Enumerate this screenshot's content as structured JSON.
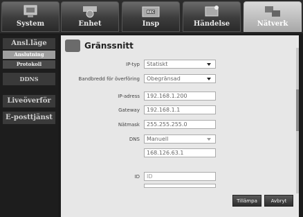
{
  "top_tabs": [
    {
      "label": "System",
      "icon": "monitor-icon"
    },
    {
      "label": "Enhet",
      "icon": "camera-icon"
    },
    {
      "label": "Insp",
      "icon": "recorder-icon"
    },
    {
      "label": "Händelse",
      "icon": "event-icon"
    },
    {
      "label": "Nätverk",
      "icon": "network-icon"
    }
  ],
  "sidebar": {
    "items": [
      {
        "label": "Ansl.läge"
      },
      {
        "label": "Anslutning"
      },
      {
        "label": "Protokoll"
      },
      {
        "label": "DDNS"
      },
      {
        "label": "Liveöverför"
      },
      {
        "label": "E-posttjänst"
      }
    ]
  },
  "page": {
    "title": "Gränssnitt",
    "fields": [
      {
        "label": "IP-typ",
        "value": "Statiskt"
      },
      {
        "label": "Bandbredd för överföring",
        "value": "Obegränsad"
      },
      {
        "label": "IP-adress",
        "value": "192.168.1.200"
      },
      {
        "label": "Gateway",
        "value": "192.168.1.1"
      },
      {
        "label": "Nätmask",
        "value": "255.255.255.0"
      },
      {
        "label": "DNS",
        "value": "Manuell"
      },
      {
        "label": "",
        "value": "168.126.63.1"
      },
      {
        "label": "ID",
        "value": "ID"
      }
    ],
    "buttons": {
      "apply": "Tillämpa",
      "cancel": "Avbryt"
    }
  },
  "colors": {
    "active_tab": "#bdbdbd",
    "content_bg": "#e7e7e7"
  }
}
